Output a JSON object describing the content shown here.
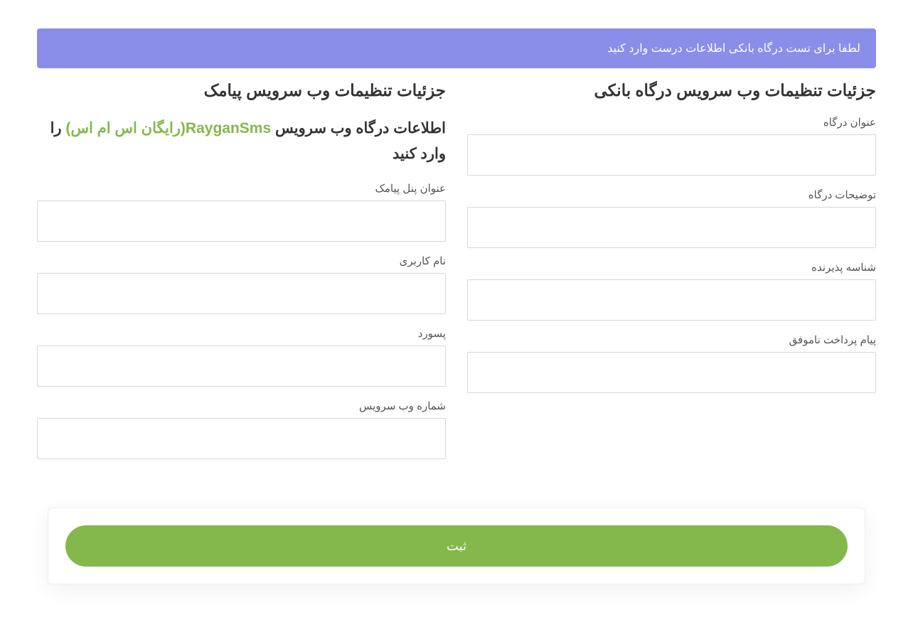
{
  "alert": {
    "message": "لطفا برای تست درگاه بانکی اطلاعات درست وارد کنید"
  },
  "gateway": {
    "heading": "جزئیات تنظیمات وب سرویس درگاه بانکی",
    "fields": {
      "title_label": "عنوان درگاه",
      "title_value": "",
      "description_label": "توضیحات درگاه",
      "description_value": "",
      "merchant_label": "شناسه پذیرنده",
      "merchant_value": "",
      "fail_message_label": "پیام پرداخت ناموفق",
      "fail_message_value": ""
    }
  },
  "sms": {
    "heading": "جزئیات تنظیمات وب سرویس پیامک",
    "subheading_prefix": "اطلاعات درگاه وب سرویس ",
    "subheading_brand": "RayganSms(رایگان اس ام اس)",
    "subheading_suffix": " را وارد کنید",
    "fields": {
      "panel_title_label": "عنوان پنل پیامک",
      "panel_title_value": "",
      "username_label": "نام کاربری",
      "username_value": "",
      "password_label": "پسورد",
      "password_value": "",
      "service_number_label": "شماره وب سرویس",
      "service_number_value": ""
    }
  },
  "actions": {
    "submit_label": "ثبت"
  }
}
